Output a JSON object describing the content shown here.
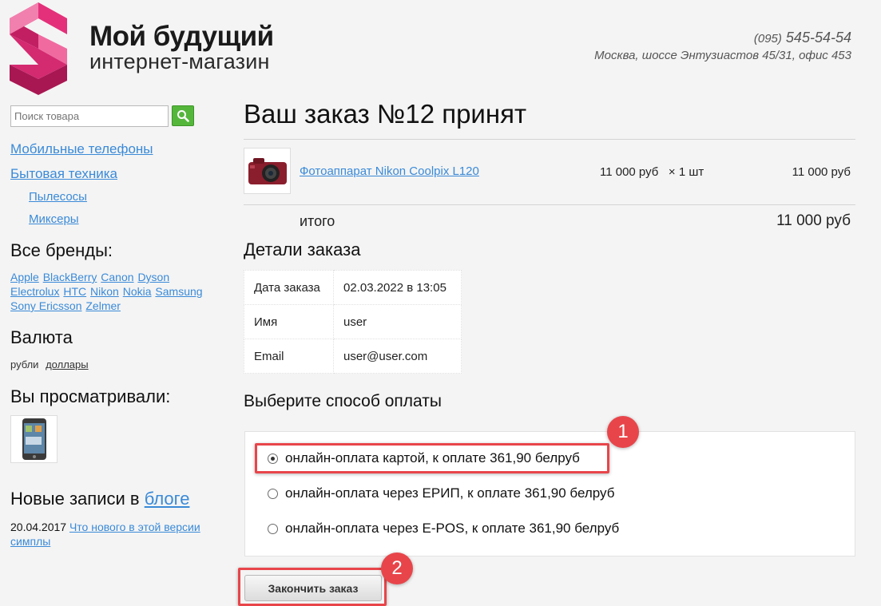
{
  "header": {
    "logo_title": "Мой будущий",
    "logo_sub": "интернет-магазин",
    "phone_code": "(095)",
    "phone_number": "545-54-54",
    "address": "Москва, шоссе Энтузиастов 45/31, офис 453"
  },
  "sidebar": {
    "search_placeholder": "Поиск товара",
    "categories": [
      {
        "label": "Мобильные телефоны"
      },
      {
        "label": "Бытовая техника"
      }
    ],
    "subcategories": [
      {
        "label": "Пылесосы"
      },
      {
        "label": "Миксеры"
      }
    ],
    "brands_title": "Все бренды:",
    "brands": [
      "Apple",
      "BlackBerry",
      "Canon",
      "Dyson",
      "Electrolux",
      "HTC",
      "Nikon",
      "Nokia",
      "Samsung",
      "Sony Ericsson",
      "Zelmer"
    ],
    "currency_title": "Валюта",
    "currency_current": "рубли",
    "currency_other": "доллары",
    "viewed_title": "Вы просматривали:",
    "blog_title": "Новые записи в",
    "blog_link": "блоге",
    "blog_date": "20.04.2017",
    "blog_post": "Что нового в этой версии симплы"
  },
  "main": {
    "title": "Ваш заказ №12 принят",
    "product": {
      "name": "Фотоаппарат Nikon Coolpix L120",
      "price": "11 000 руб",
      "qty": "× 1 шт",
      "total": "11 000 руб"
    },
    "itogo_label": "итого",
    "itogo_sum": "11 000 руб",
    "details_title": "Детали заказа",
    "details": [
      {
        "key": "Дата заказа",
        "value": "02.03.2022 в 13:05"
      },
      {
        "key": "Имя",
        "value": "user"
      },
      {
        "key": "Email",
        "value": "user@user.com"
      }
    ],
    "payment_title": "Выберите способ оплаты",
    "payment_options": [
      {
        "label": "онлайн-оплата картой, к оплате 361,90 белруб",
        "selected": true
      },
      {
        "label": "онлайн-оплата через ЕРИП, к оплате 361,90 белруб",
        "selected": false
      },
      {
        "label": "онлайн-оплата через E-POS, к оплате 361,90 белруб",
        "selected": false
      }
    ],
    "finish_button": "Закончить заказ"
  },
  "annotations": {
    "badge_1": "1",
    "badge_2": "2",
    "accent_color": "#e8454a"
  }
}
